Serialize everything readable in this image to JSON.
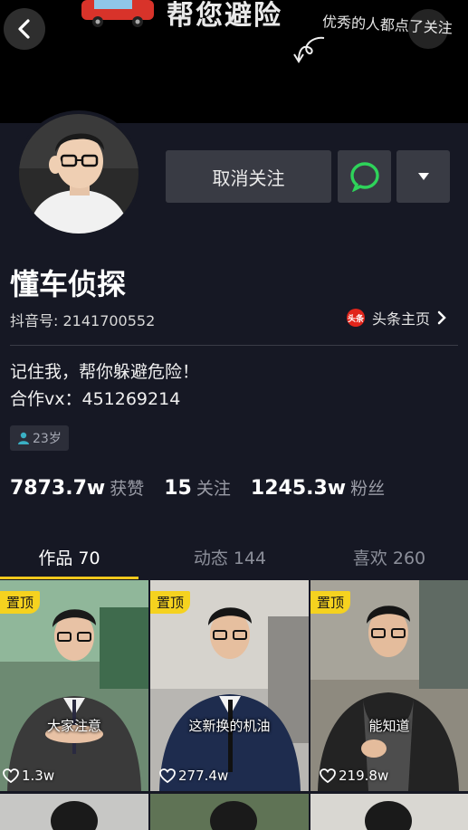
{
  "banner": {
    "title_partial": "帮您避险",
    "subtitle": "优秀的人都点了关注"
  },
  "profile": {
    "name": "懂车侦探",
    "douyin_id": "抖音号: 2141700552",
    "toutiao_label": "头条主页",
    "toutiao_logo_text": "头条",
    "bio_line1": "记住我，帮你躲避危险！",
    "bio_line2": "合作vx：451269214",
    "age": "23岁"
  },
  "actions": {
    "unfollow_label": "取消关注"
  },
  "stats": [
    {
      "value": "7873.7w",
      "label": "获赞"
    },
    {
      "value": "15",
      "label": "关注"
    },
    {
      "value": "1245.3w",
      "label": "粉丝"
    }
  ],
  "tabs": [
    {
      "label": "作品 70"
    },
    {
      "label": "动态 144"
    },
    {
      "label": "喜欢 260"
    }
  ],
  "videos": [
    {
      "pin": "置顶",
      "caption": "大家注意",
      "likes": "1.3w"
    },
    {
      "pin": "置顶",
      "caption": "这新换的机油",
      "likes": "277.4w"
    },
    {
      "pin": "置顶",
      "caption": "能知道",
      "likes": "219.8w"
    }
  ],
  "colors": {
    "background": "#161824",
    "accent": "#f5c81c",
    "button": "#393b44",
    "message_green": "#2ed35a"
  }
}
